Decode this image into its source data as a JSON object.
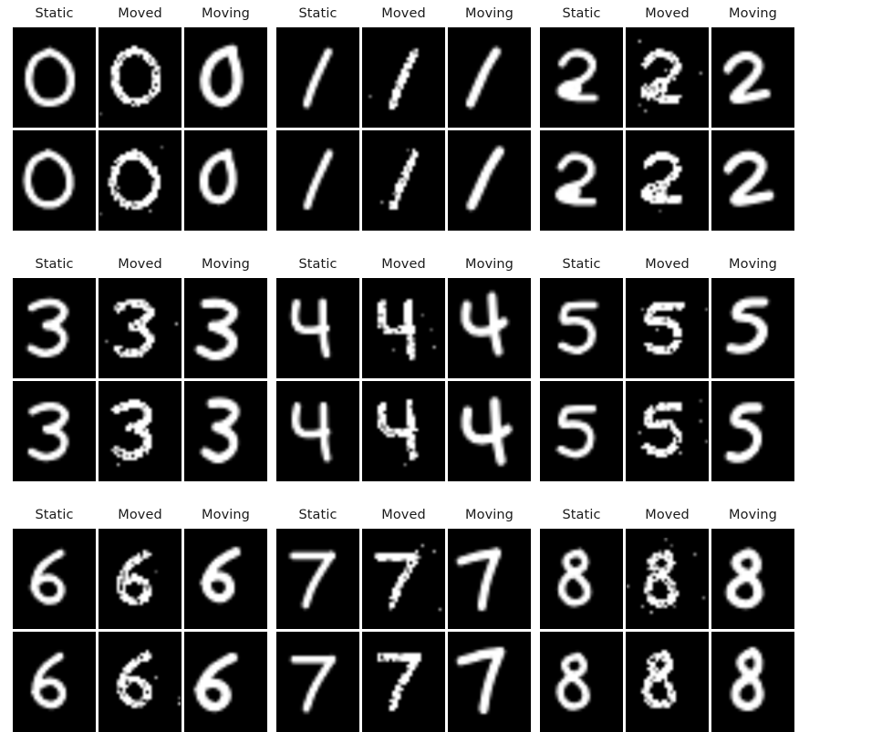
{
  "figure": {
    "title": "",
    "background_color": "#ffffff",
    "image_background_color": "#000000",
    "digit_color": "#ffffff",
    "label_color": "#1a1a1a",
    "rows_of_blocks": 3,
    "blocks_per_row": 3,
    "columns_per_block": 3,
    "image_rows_per_block": 2
  },
  "column_labels": [
    "Static",
    "Moved",
    "Moving"
  ],
  "blocks": [
    {
      "digit": "0",
      "labels": [
        "Static",
        "Moved",
        "Moving"
      ],
      "rows": [
        [
          {
            "label": "Static",
            "digit": "0",
            "variant": "static",
            "row": 0
          },
          {
            "label": "Moved",
            "digit": "0",
            "variant": "moved",
            "row": 0
          },
          {
            "label": "Moving",
            "digit": "0",
            "variant": "moving",
            "row": 0
          }
        ],
        [
          {
            "label": "Static",
            "digit": "0",
            "variant": "static",
            "row": 1
          },
          {
            "label": "Moved",
            "digit": "0",
            "variant": "moved",
            "row": 1
          },
          {
            "label": "Moving",
            "digit": "0",
            "variant": "moving",
            "row": 1
          }
        ]
      ]
    },
    {
      "digit": "1",
      "labels": [
        "Static",
        "Moved",
        "Moving"
      ],
      "rows": [
        [
          {
            "label": "Static",
            "digit": "1",
            "variant": "static",
            "row": 0
          },
          {
            "label": "Moved",
            "digit": "1",
            "variant": "moved",
            "row": 0
          },
          {
            "label": "Moving",
            "digit": "1",
            "variant": "moving",
            "row": 0
          }
        ],
        [
          {
            "label": "Static",
            "digit": "1",
            "variant": "static",
            "row": 1
          },
          {
            "label": "Moved",
            "digit": "1",
            "variant": "moved",
            "row": 1
          },
          {
            "label": "Moving",
            "digit": "1",
            "variant": "moving",
            "row": 1
          }
        ]
      ]
    },
    {
      "digit": "2",
      "labels": [
        "Static",
        "Moved",
        "Moving"
      ],
      "rows": [
        [
          {
            "label": "Static",
            "digit": "2",
            "variant": "static",
            "row": 0
          },
          {
            "label": "Moved",
            "digit": "2",
            "variant": "moved",
            "row": 0
          },
          {
            "label": "Moving",
            "digit": "2",
            "variant": "moving",
            "row": 0
          }
        ],
        [
          {
            "label": "Static",
            "digit": "2",
            "variant": "static",
            "row": 1
          },
          {
            "label": "Moved",
            "digit": "2",
            "variant": "moved",
            "row": 1
          },
          {
            "label": "Moving",
            "digit": "2",
            "variant": "moving",
            "row": 1
          }
        ]
      ]
    },
    {
      "digit": "3",
      "labels": [
        "Static",
        "Moved",
        "Moving"
      ],
      "rows": [
        [
          {
            "label": "Static",
            "digit": "3",
            "variant": "static",
            "row": 0
          },
          {
            "label": "Moved",
            "digit": "3",
            "variant": "moved",
            "row": 0
          },
          {
            "label": "Moving",
            "digit": "3",
            "variant": "moving",
            "row": 0
          }
        ],
        [
          {
            "label": "Static",
            "digit": "3",
            "variant": "static",
            "row": 1
          },
          {
            "label": "Moved",
            "digit": "3",
            "variant": "moved",
            "row": 1
          },
          {
            "label": "Moving",
            "digit": "3",
            "variant": "moving",
            "row": 1
          }
        ]
      ]
    },
    {
      "digit": "4",
      "labels": [
        "Static",
        "Moved",
        "Moving"
      ],
      "rows": [
        [
          {
            "label": "Static",
            "digit": "4",
            "variant": "static",
            "row": 0
          },
          {
            "label": "Moved",
            "digit": "4",
            "variant": "moved",
            "row": 0
          },
          {
            "label": "Moving",
            "digit": "4",
            "variant": "moving",
            "row": 0
          }
        ],
        [
          {
            "label": "Static",
            "digit": "4",
            "variant": "static",
            "row": 1
          },
          {
            "label": "Moved",
            "digit": "4",
            "variant": "moved",
            "row": 1
          },
          {
            "label": "Moving",
            "digit": "4",
            "variant": "moving",
            "row": 1
          }
        ]
      ]
    },
    {
      "digit": "5",
      "labels": [
        "Static",
        "Moved",
        "Moving"
      ],
      "rows": [
        [
          {
            "label": "Static",
            "digit": "5",
            "variant": "static",
            "row": 0
          },
          {
            "label": "Moved",
            "digit": "5",
            "variant": "moved",
            "row": 0
          },
          {
            "label": "Moving",
            "digit": "5",
            "variant": "moving",
            "row": 0
          }
        ],
        [
          {
            "label": "Static",
            "digit": "5",
            "variant": "static",
            "row": 1
          },
          {
            "label": "Moved",
            "digit": "5",
            "variant": "moved",
            "row": 1
          },
          {
            "label": "Moving",
            "digit": "5",
            "variant": "moving",
            "row": 1
          }
        ]
      ]
    },
    {
      "digit": "6",
      "labels": [
        "Static",
        "Moved",
        "Moving"
      ],
      "rows": [
        [
          {
            "label": "Static",
            "digit": "6",
            "variant": "static",
            "row": 0
          },
          {
            "label": "Moved",
            "digit": "6",
            "variant": "moved",
            "row": 0
          },
          {
            "label": "Moving",
            "digit": "6",
            "variant": "moving",
            "row": 0
          }
        ],
        [
          {
            "label": "Static",
            "digit": "6",
            "variant": "static",
            "row": 1
          },
          {
            "label": "Moved",
            "digit": "6",
            "variant": "moved",
            "row": 1
          },
          {
            "label": "Moving",
            "digit": "6",
            "variant": "moving",
            "row": 1
          }
        ]
      ]
    },
    {
      "digit": "7",
      "labels": [
        "Static",
        "Moved",
        "Moving"
      ],
      "rows": [
        [
          {
            "label": "Static",
            "digit": "7",
            "variant": "static",
            "row": 0
          },
          {
            "label": "Moved",
            "digit": "7",
            "variant": "moved",
            "row": 0
          },
          {
            "label": "Moving",
            "digit": "7",
            "variant": "moving",
            "row": 0
          }
        ],
        [
          {
            "label": "Static",
            "digit": "7",
            "variant": "static",
            "row": 1
          },
          {
            "label": "Moved",
            "digit": "7",
            "variant": "moved",
            "row": 1
          },
          {
            "label": "Moving",
            "digit": "7",
            "variant": "moving",
            "row": 1
          }
        ]
      ]
    },
    {
      "digit": "8",
      "labels": [
        "Static",
        "Moved",
        "Moving"
      ],
      "rows": [
        [
          {
            "label": "Static",
            "digit": "8",
            "variant": "static",
            "row": 0
          },
          {
            "label": "Moved",
            "digit": "8",
            "variant": "moved",
            "row": 0
          },
          {
            "label": "Moving",
            "digit": "8",
            "variant": "moving",
            "row": 0
          }
        ],
        [
          {
            "label": "Static",
            "digit": "8",
            "variant": "static",
            "row": 1
          },
          {
            "label": "Moved",
            "digit": "8",
            "variant": "moved",
            "row": 1
          },
          {
            "label": "Moving",
            "digit": "8",
            "variant": "moving",
            "row": 1
          }
        ]
      ]
    }
  ]
}
